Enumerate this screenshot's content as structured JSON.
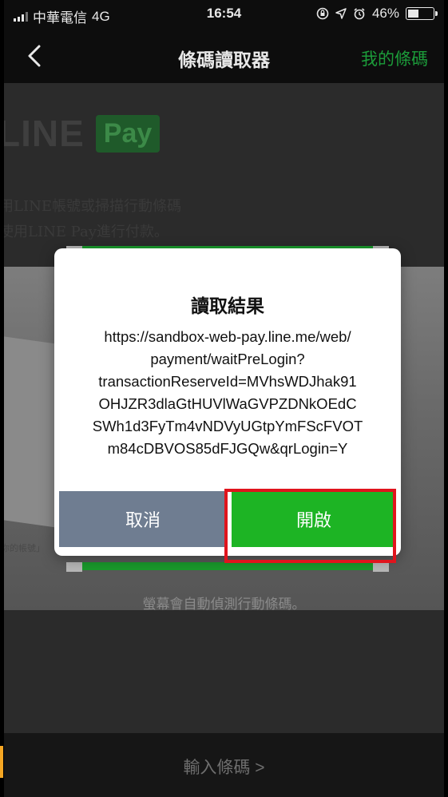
{
  "status_bar": {
    "carrier": "中華電信",
    "network": "4G",
    "time": "16:54",
    "battery": "46%",
    "battery_level": 0.46
  },
  "nav": {
    "title": "條碼讀取器",
    "right_link": "我的條碼"
  },
  "camera": {
    "brand_line": "LINE",
    "brand_pay": "Pay",
    "text_line1": "用LINE帳號或掃描行動條碼",
    "text_line2": "使用LINE Pay進行付款。",
    "paper_text": "你的帳號」",
    "detect_hint": "螢幕會自動偵測行動條碼。"
  },
  "dialog": {
    "title": "讀取結果",
    "message_lines": [
      "https://sandbox-web-pay.line.me/web/",
      "payment/waitPreLogin?",
      "transactionReserveId=MVhsWDJhak91",
      "OHJZR3dlaGtHUVlWaGVPZDNkOEdC",
      "SWh1d3FyTm4vNDVyUGtpYmFScFVOT",
      "m84cDBVOS85dFJGQw&qrLogin=Y"
    ],
    "cancel_label": "取消",
    "open_label": "開啟"
  },
  "bottom": {
    "label": "輸入條碼 >"
  },
  "colors": {
    "accent_green": "#1db424",
    "cancel_gray": "#6f7d91",
    "highlight_red": "#e0141d",
    "nav_link_green": "#1c9c3a"
  }
}
